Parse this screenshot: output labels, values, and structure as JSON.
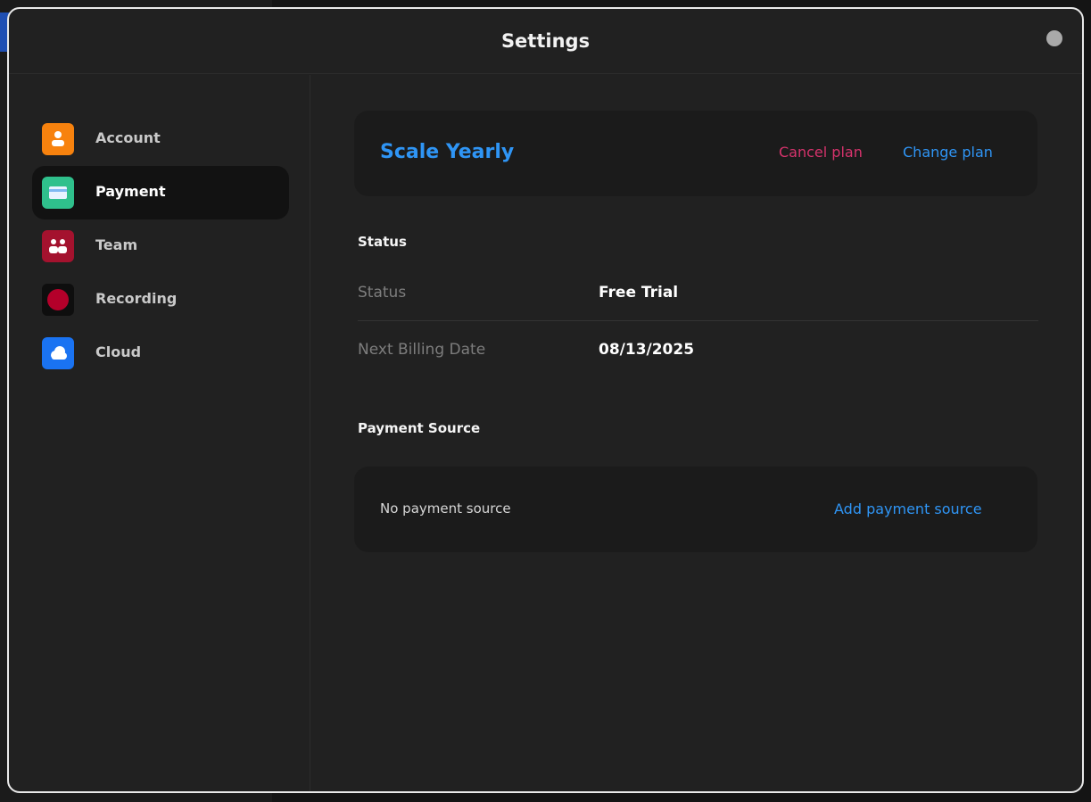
{
  "window": {
    "title": "Settings"
  },
  "sidebar": {
    "items": [
      {
        "label": "Account",
        "icon": "user-icon",
        "color": "#f7820e"
      },
      {
        "label": "Payment",
        "icon": "credit-card-icon",
        "color": "#2fc08c",
        "active": true
      },
      {
        "label": "Team",
        "icon": "team-icon",
        "color": "#a4122e"
      },
      {
        "label": "Recording",
        "icon": "record-icon",
        "color": "#b4002a"
      },
      {
        "label": "Cloud",
        "icon": "cloud-icon",
        "color": "#1a73f2"
      }
    ]
  },
  "plan": {
    "name": "Scale Yearly",
    "cancel_label": "Cancel plan",
    "change_label": "Change plan"
  },
  "status_section": {
    "title": "Status",
    "rows": [
      {
        "label": "Status",
        "value": "Free Trial"
      },
      {
        "label": "Next Billing Date",
        "value": "08/13/2025"
      }
    ]
  },
  "payment_source": {
    "title": "Payment Source",
    "empty_text": "No payment source",
    "add_label": "Add payment source"
  },
  "colors": {
    "accent_blue": "#2f95f5",
    "danger_pink": "#d6336c"
  }
}
